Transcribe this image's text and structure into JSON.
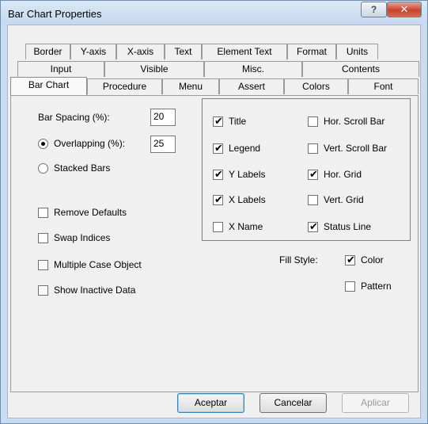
{
  "window": {
    "title": "Bar Chart Properties",
    "help_glyph": "?",
    "close_glyph": "✕"
  },
  "tabs": {
    "row1": [
      "Border",
      "Y-axis",
      "X-axis",
      "Text",
      "Element Text",
      "Format",
      "Units"
    ],
    "row2": [
      "Input",
      "Visible",
      "Misc.",
      "Contents"
    ],
    "row3": [
      "Bar Chart",
      "Procedure",
      "Menu",
      "Assert",
      "Colors",
      "Font"
    ],
    "selected": "Bar Chart"
  },
  "bar_chart": {
    "bar_spacing_label": "Bar Spacing (%):",
    "bar_spacing_value": "20",
    "overlapping_label": "Overlapping (%):",
    "overlapping_value": "25",
    "overlapping_selected": true,
    "stacked_label": "Stacked Bars",
    "stacked_selected": false,
    "remove_defaults": {
      "label": "Remove Defaults",
      "checked": false
    },
    "swap_indices": {
      "label": "Swap Indices",
      "checked": false
    },
    "multiple_case": {
      "label": "Multiple Case Object",
      "checked": false
    },
    "show_inactive": {
      "label": "Show Inactive Data",
      "checked": false
    }
  },
  "display_options": {
    "left": [
      {
        "label": "Title",
        "checked": true
      },
      {
        "label": "Legend",
        "checked": true
      },
      {
        "label": "Y Labels",
        "checked": true
      },
      {
        "label": "X Labels",
        "checked": true
      },
      {
        "label": "X Name",
        "checked": false
      }
    ],
    "right": [
      {
        "label": "Hor. Scroll Bar",
        "checked": false
      },
      {
        "label": "Vert. Scroll Bar",
        "checked": false
      },
      {
        "label": "Hor. Grid",
        "checked": true
      },
      {
        "label": "Vert. Grid",
        "checked": false
      },
      {
        "label": "Status Line",
        "checked": true
      }
    ]
  },
  "fill_style": {
    "label": "Fill Style:",
    "color": {
      "label": "Color",
      "checked": true
    },
    "pattern": {
      "label": "Pattern",
      "checked": false
    }
  },
  "buttons": {
    "accept": "Aceptar",
    "cancel": "Cancelar",
    "apply": "Aplicar"
  },
  "check_glyph": "✔"
}
